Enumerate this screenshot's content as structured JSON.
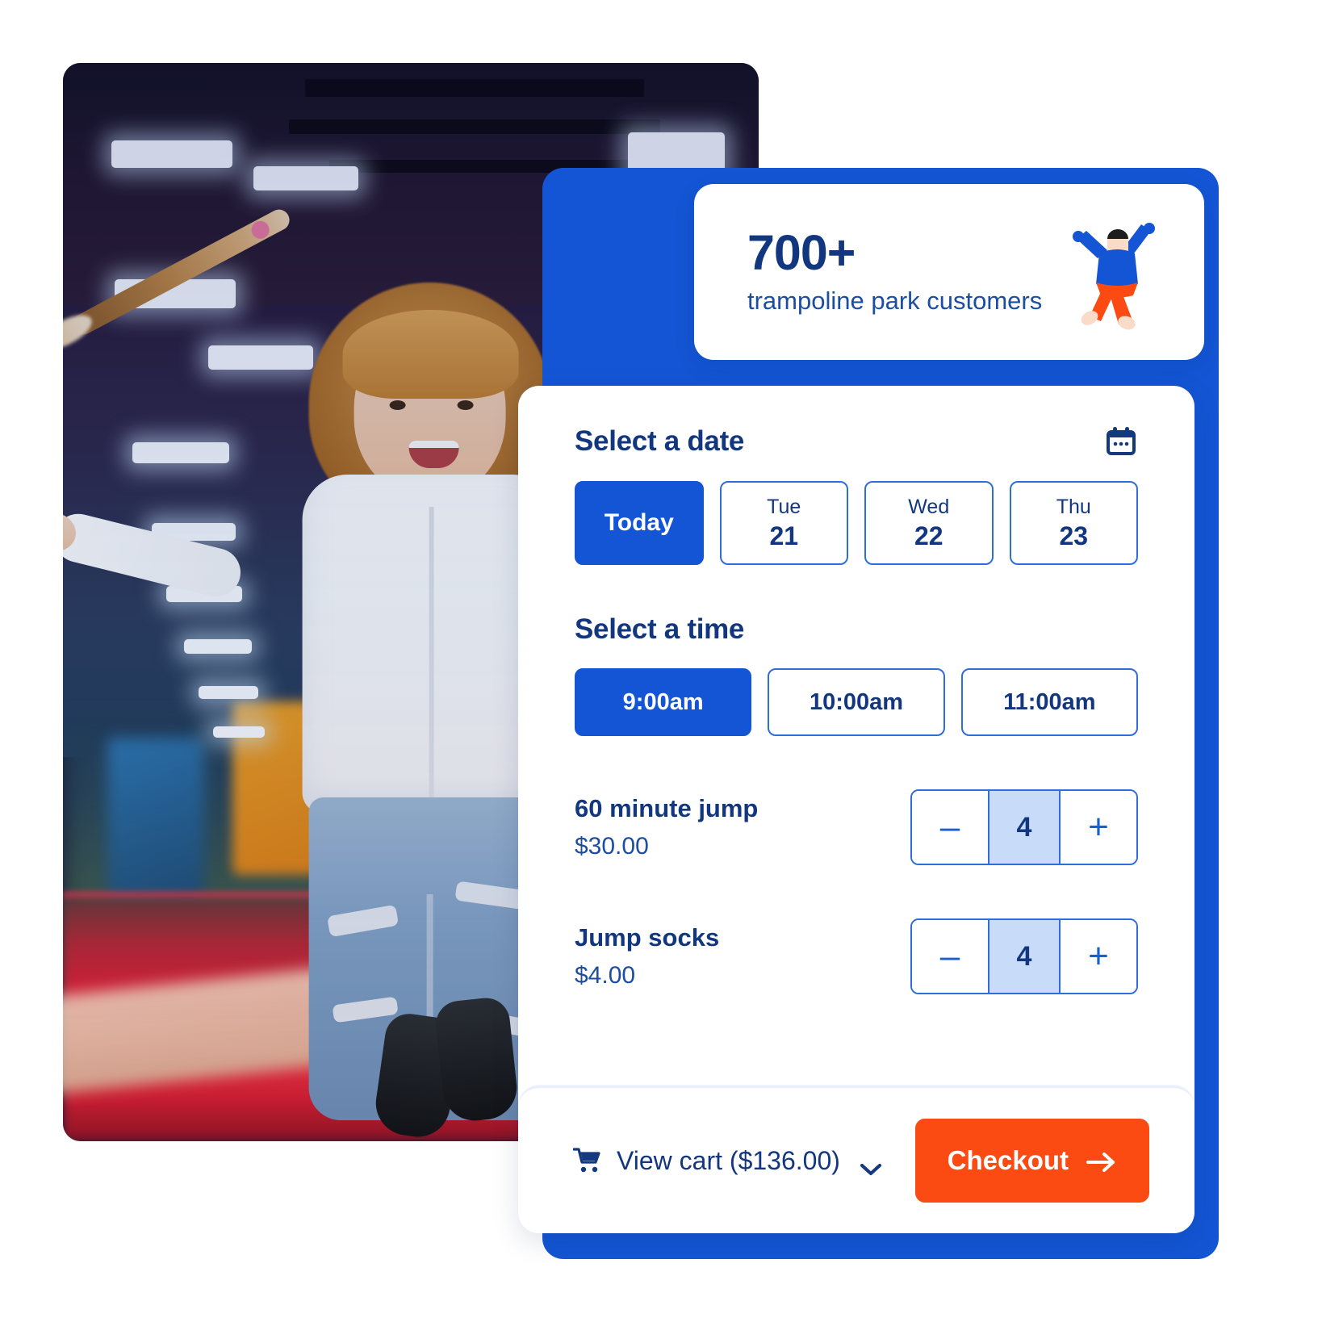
{
  "stat_card": {
    "number": "700+",
    "label": "trampoline park customers",
    "illustration": "jumping-person-illustration"
  },
  "booking": {
    "date_section": {
      "title": "Select a date",
      "icon": "calendar-icon",
      "options": [
        {
          "dow": "",
          "day": "Today",
          "selected": true
        },
        {
          "dow": "Tue",
          "day": "21",
          "selected": false
        },
        {
          "dow": "Wed",
          "day": "22",
          "selected": false
        },
        {
          "dow": "Thu",
          "day": "23",
          "selected": false
        }
      ]
    },
    "time_section": {
      "title": "Select a time",
      "options": [
        {
          "label": "9:00am",
          "selected": true
        },
        {
          "label": "10:00am",
          "selected": false
        },
        {
          "label": "11:00am",
          "selected": false
        }
      ]
    },
    "products": [
      {
        "name": "60 minute jump",
        "price": "$30.00",
        "quantity": "4",
        "minus": "–",
        "plus": "+"
      },
      {
        "name": "Jump socks",
        "price": "$4.00",
        "quantity": "4",
        "minus": "–",
        "plus": "+"
      }
    ],
    "footer": {
      "cart_label": "View cart ($136.00)",
      "cart_icon": "shopping-cart-icon",
      "chevron_icon": "chevron-down-icon",
      "checkout_label": "Checkout",
      "checkout_icon": "arrow-right-icon"
    }
  },
  "colors": {
    "primary_blue": "#1355d4",
    "navy": "#13377f",
    "accent_orange": "#fb4a12",
    "stepper_fill": "#c8dbf8",
    "border_blue": "#2f6ddb"
  }
}
